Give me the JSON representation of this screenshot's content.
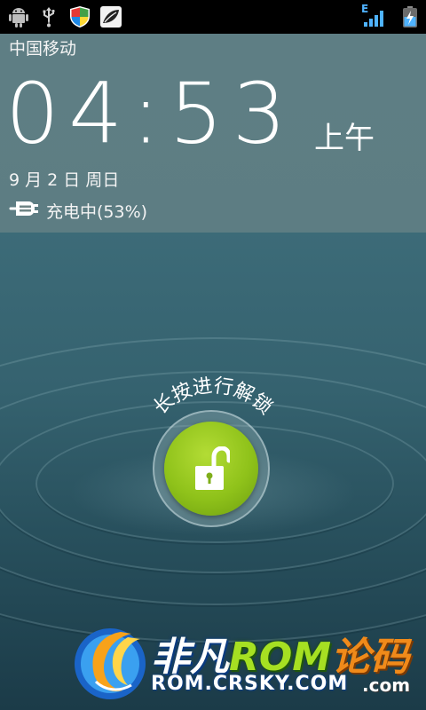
{
  "status_bar": {
    "icons_left": [
      "android-debug-icon",
      "usb-icon",
      "shield-icon",
      "leaf-app-icon"
    ],
    "network_label": "E",
    "icons_right": [
      "signal-icon",
      "battery-charging-icon"
    ]
  },
  "lock_info": {
    "carrier": "中国移动",
    "time": "04:53",
    "ampm": "上午",
    "date": "9 月 2 日 周日",
    "charging": "充电中(53%)"
  },
  "unlock": {
    "hint": "长按进行解锁",
    "icon": "unlocked-padlock-icon",
    "accent": "#8fc21a"
  },
  "watermark": {
    "brand_cn": "非凡",
    "brand_rom": "ROM",
    "brand_tail": "论码",
    "url": "ROM.CRSKY.COM",
    "url_tail": ".com"
  }
}
